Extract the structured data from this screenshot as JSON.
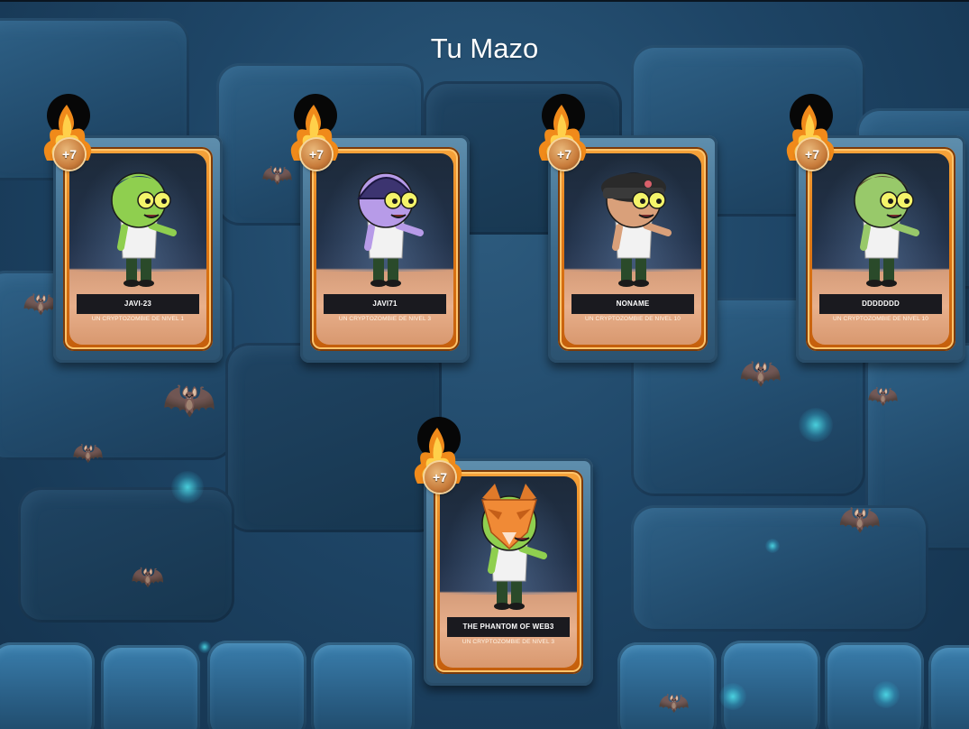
{
  "title": "Tu Mazo",
  "cards": [
    {
      "name": "JAVI-23",
      "level_text": "UN CRYPTOZOMBIE DE NIVEL 1",
      "badge": "+7",
      "skin": "#8fcf4f",
      "hair": "#1f3a6a",
      "hat": "none"
    },
    {
      "name": "JAVI71",
      "level_text": "UN CRYPTOZOMBIE DE NIVEL 3",
      "badge": "+7",
      "skin": "#b79be8",
      "hair": "#3c3470",
      "hat": "helmet"
    },
    {
      "name": "NONAME",
      "level_text": "UN CRYPTOZOMBIE DE NIVEL 10",
      "badge": "+7",
      "skin": "#d9a07a",
      "hair": "#2a2a2a",
      "hat": "cap"
    },
    {
      "name": "DDDDDDD",
      "level_text": "UN CRYPTOZOMBIE DE NIVEL 10",
      "badge": "+7",
      "skin": "#98c96a",
      "hair": "#5a4630",
      "hat": "none"
    },
    {
      "name": "THE PHANTOM OF WEB3",
      "level_text": "UN CRYPTOZOMBIE DE NIVEL 3",
      "badge": "+7",
      "skin": "#8fcf4f",
      "hair": "#3a3a3a",
      "hat": "fox-mask"
    }
  ],
  "icons": {
    "badge": "flame-icon",
    "bat": "bat-icon"
  }
}
